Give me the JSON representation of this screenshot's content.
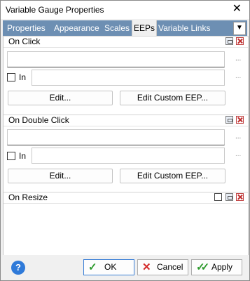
{
  "window": {
    "title": "Variable Gauge Properties"
  },
  "tabs": {
    "items": [
      "Properties",
      "Appearance",
      "Scales",
      "EEPs",
      "Variable Links"
    ],
    "active": "EEPs"
  },
  "sections": [
    {
      "title": "On Click",
      "in_label": "In",
      "edit_label": "Edit...",
      "edit_custom_label": "Edit Custom EEP...",
      "ellipsis": "..."
    },
    {
      "title": "On Double Click",
      "in_label": "In",
      "edit_label": "Edit...",
      "edit_custom_label": "Edit Custom EEP...",
      "ellipsis": "..."
    },
    {
      "title": "On Resize"
    }
  ],
  "footer": {
    "help_label": "?",
    "ok_label": "OK",
    "cancel_label": "Cancel",
    "apply_label": "Apply"
  },
  "icons": {
    "close": "close-icon",
    "dropdown": "chevron-down-icon",
    "help": "help-icon",
    "ok": "checkmark-icon",
    "cancel": "cross-icon",
    "apply": "double-checkmark-icon"
  },
  "colors": {
    "tab_bar": "#6d8fb3",
    "help": "#2f7ad9",
    "ok_check": "#2e9b2e",
    "cancel_x": "#d42a2a",
    "section_close": "#c03030"
  }
}
